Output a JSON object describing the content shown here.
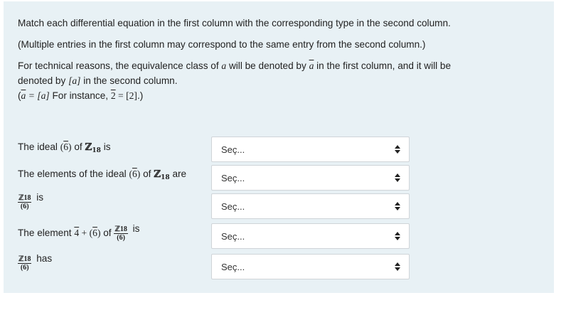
{
  "intro": {
    "p1": "Match each differential equation in the first column with the corresponding type in the second column.",
    "p2": "(Multiple entries in the first column may correspond to the same entry from the second column.)",
    "p3_a": "For technical reasons, the equivalence class of",
    "p3_a_var": "a",
    "p3_b": "will be denoted by",
    "p3_b_var": "a",
    "p3_c": "in the first column, and it will be",
    "p3_d": "denoted by",
    "p3_d_var": "[a]",
    "p3_e": "in the second column.",
    "p3_f_open": "(",
    "p3_f_var": "a",
    "p3_f_eq": " = [a]",
    "p3_f_text": "For instance,",
    "p3_f_two": "2",
    "p3_f_eq2": " = [2]",
    "p3_f_close": ".)"
  },
  "rows": [
    {
      "prefix": "The ideal",
      "ideal": "(6)",
      "of": "of",
      "ring": "ℤ",
      "ring_sub": "18",
      "suffix": "is",
      "select": "Seç..."
    },
    {
      "prefix": "The elements of the ideal",
      "ideal": "(6)",
      "of": "of",
      "ring": "ℤ",
      "ring_sub": "18",
      "suffix": "are",
      "select": "Seç..."
    },
    {
      "frac_num": "ℤ18",
      "frac_den": "(6)",
      "suffix": "is",
      "select": "Seç..."
    },
    {
      "prefix": "The element",
      "elem": "4",
      "plus": " + ",
      "ideal": "(6)",
      "of": "of",
      "frac_num": "ℤ18",
      "frac_den": "(6)",
      "suffix": "is",
      "select": "Seç..."
    },
    {
      "frac_num": "ℤ18",
      "frac_den": "(6)",
      "suffix": "has",
      "select": "Seç..."
    }
  ]
}
